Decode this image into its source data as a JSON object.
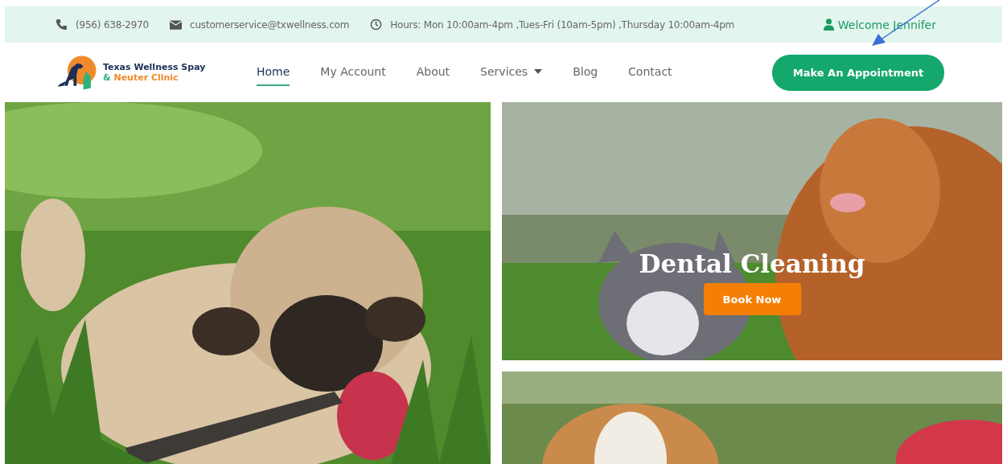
{
  "top_bar": {
    "phone": "(956) 638-2970",
    "email": "customerservice@txwellness.com",
    "hours": "Hours: Mon 10:00am-4pm ,Tues-Fri (10am-5pm) ,Thursday 10:00am-4pm",
    "welcome": "Welcome Jennifer"
  },
  "logo": {
    "line1": "Texas Wellness Spay",
    "line2_amp": "&",
    "line2": "Neuter Clinic"
  },
  "nav": [
    {
      "label": "Home",
      "selected": true,
      "dropdown": false
    },
    {
      "label": "My Account",
      "selected": false,
      "dropdown": false
    },
    {
      "label": "About",
      "selected": false,
      "dropdown": false
    },
    {
      "label": "Services",
      "selected": false,
      "dropdown": true
    },
    {
      "label": "Blog",
      "selected": false,
      "dropdown": false
    },
    {
      "label": "Contact",
      "selected": false,
      "dropdown": false
    }
  ],
  "cta": "Make An Appointment",
  "promo": {
    "title": "Dental Cleaning",
    "button": "Book Now"
  }
}
